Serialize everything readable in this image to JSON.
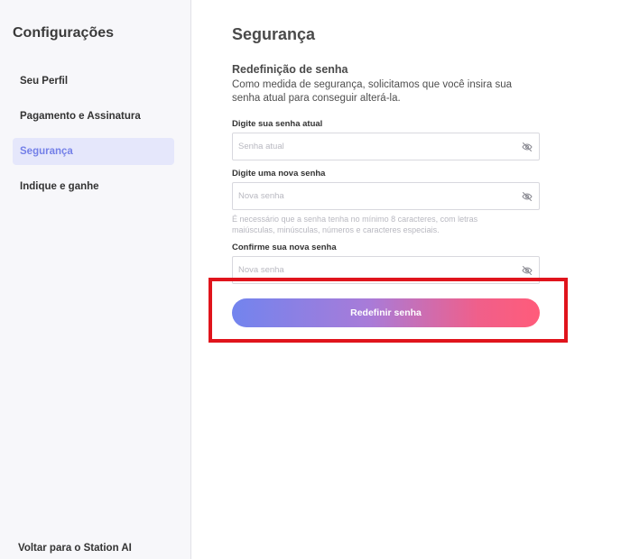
{
  "sidebar": {
    "title": "Configurações",
    "items": [
      {
        "label": "Seu Perfil",
        "active": false
      },
      {
        "label": "Pagamento e Assinatura",
        "active": false
      },
      {
        "label": "Segurança",
        "active": true
      },
      {
        "label": "Indique e ganhe",
        "active": false
      }
    ],
    "back_label": "Voltar para o Station AI"
  },
  "main": {
    "title": "Segurança",
    "section_title": "Redefinição de senha",
    "section_desc": "Como medida de segurança, solicitamos que você insira sua senha atual para conseguir alterá-la.",
    "fields": [
      {
        "label": "Digite sua senha atual",
        "placeholder": "Senha atual",
        "value": ""
      },
      {
        "label": "Digite uma nova senha",
        "placeholder": "Nova senha",
        "value": ""
      },
      {
        "label": "Confirme sua nova senha",
        "placeholder": "Nova senha",
        "value": ""
      }
    ],
    "hint": "É necessário que a senha tenha no mínimo 8 caracteres, com letras maiúsculas, minúsculas, números e caracteres especiais.",
    "submit_label": "Redefinir senha"
  },
  "colors": {
    "accent": "#7480e8",
    "active_bg": "#e5e7fb",
    "gradient_start": "#7284ee",
    "gradient_end": "#ff5c7a",
    "highlight": "#e0141c"
  },
  "icons": {
    "password_toggle": "eye-off-icon"
  }
}
